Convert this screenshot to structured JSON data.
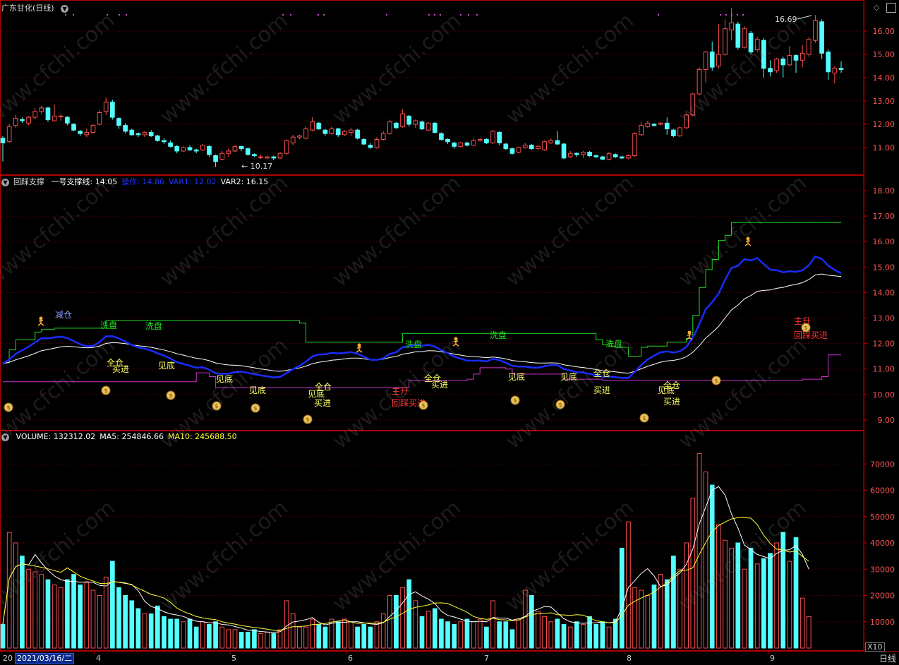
{
  "title": "广东甘化(日线)",
  "panel1": {
    "name": "回踩支撑",
    "fields": [
      {
        "label": "一号支撑线:",
        "value": "14.05",
        "color": "#ffffff"
      },
      {
        "label": "操作:",
        "value": "14.86",
        "color": "#2233ff"
      },
      {
        "label": "VAR1:",
        "value": "12.02",
        "color": "#2233ff"
      },
      {
        "label": "VAR2:",
        "value": "16.15",
        "color": "#ffffff"
      }
    ]
  },
  "panel2": {
    "fields": [
      {
        "label": "VOLUME:",
        "value": "132312.02",
        "color": "#ffffff"
      },
      {
        "label": "MA5:",
        "value": "254846.66",
        "color": "#ffffff"
      },
      {
        "label": "MA10:",
        "value": "245688.50",
        "color": "#ffff33"
      }
    ]
  },
  "price_axis": [
    "16.00",
    "15.00",
    "14.00",
    "13.00",
    "12.00",
    "11.00"
  ],
  "ind_axis": [
    "18.00",
    "17.00",
    "16.00",
    "15.00",
    "14.00",
    "13.00",
    "12.00",
    "11.00",
    "10.00",
    "9.00"
  ],
  "vol_axis": [
    "70000",
    "60000",
    "50000",
    "40000",
    "30000",
    "20000",
    "10000"
  ],
  "high_label": "16.69",
  "low_label": "10.17",
  "x_labels": [
    "20",
    "4",
    "5",
    "6",
    "7",
    "8",
    "9"
  ],
  "date_selected": "2021/03/16/二",
  "period_tab": "日线",
  "scale_label": "X10",
  "watermark": "www.cfchi.com",
  "signals": {
    "jiancang": "减仓",
    "xipan": "洗盘",
    "jiandi": "见底",
    "quancang": "全仓",
    "mairu": "买进",
    "zhusheng": "主升",
    "huicai": "回踩买进"
  },
  "colors": {
    "up": "#ff4f4f",
    "down": "#54ffff",
    "grid": "#7a0000",
    "border": "#b00000",
    "axis_text": "#ff5555"
  },
  "chart_data": {
    "type": "candlestick",
    "candles": [
      [
        11.4,
        11.2,
        10.4,
        11.5
      ],
      [
        11.25,
        11.9,
        11.2,
        12.0
      ],
      [
        11.95,
        12.25,
        11.85,
        12.4
      ],
      [
        12.2,
        12.15,
        12.05,
        12.3
      ],
      [
        12.05,
        12.3,
        11.95,
        12.35
      ],
      [
        12.3,
        12.55,
        12.2,
        12.7
      ],
      [
        12.55,
        12.7,
        12.45,
        12.8
      ],
      [
        12.7,
        12.2,
        12.1,
        12.75
      ],
      [
        12.15,
        12.35,
        12.1,
        12.85
      ],
      [
        12.35,
        12.35,
        12.15,
        12.45
      ],
      [
        12.3,
        12.05,
        11.95,
        12.35
      ],
      [
        12.0,
        11.75,
        11.7,
        12.05
      ],
      [
        11.7,
        11.6,
        11.5,
        11.75
      ],
      [
        11.55,
        11.65,
        11.45,
        11.8
      ],
      [
        11.65,
        11.95,
        11.6,
        12.0
      ],
      [
        12.0,
        12.5,
        11.95,
        12.6
      ],
      [
        12.55,
        12.95,
        12.4,
        13.15
      ],
      [
        12.95,
        12.3,
        12.2,
        13.05
      ],
      [
        12.25,
        11.95,
        11.8,
        12.3
      ],
      [
        11.95,
        11.7,
        11.6,
        12.05
      ],
      [
        11.75,
        11.55,
        11.5,
        11.8
      ],
      [
        11.6,
        11.55,
        11.45,
        11.65
      ],
      [
        11.55,
        11.65,
        11.45,
        11.7
      ],
      [
        11.65,
        11.5,
        11.45,
        11.75
      ],
      [
        11.5,
        11.3,
        11.25,
        11.55
      ],
      [
        11.3,
        11.25,
        11.15,
        11.4
      ],
      [
        11.2,
        11.05,
        11.0,
        11.3
      ],
      [
        11.05,
        10.85,
        10.75,
        11.1
      ],
      [
        10.85,
        11.0,
        10.8,
        11.05
      ],
      [
        11.0,
        10.9,
        10.85,
        11.1
      ],
      [
        10.9,
        10.85,
        10.75,
        10.95
      ],
      [
        10.9,
        11.1,
        10.85,
        11.15
      ],
      [
        11.05,
        10.7,
        10.6,
        11.1
      ],
      [
        10.65,
        10.4,
        10.17,
        10.7
      ],
      [
        10.5,
        10.75,
        10.45,
        10.85
      ],
      [
        10.75,
        10.85,
        10.6,
        10.95
      ],
      [
        10.85,
        11.05,
        10.8,
        11.1
      ],
      [
        11.05,
        10.95,
        10.85,
        11.05
      ],
      [
        10.95,
        10.7,
        10.65,
        11.0
      ],
      [
        10.7,
        10.65,
        10.6,
        10.75
      ],
      [
        10.6,
        10.6,
        10.5,
        10.7
      ],
      [
        10.55,
        10.6,
        10.5,
        10.65
      ],
      [
        10.6,
        10.55,
        10.45,
        10.65
      ],
      [
        10.55,
        10.75,
        10.5,
        10.8
      ],
      [
        10.75,
        11.3,
        10.7,
        11.35
      ],
      [
        11.2,
        11.45,
        11.1,
        11.55
      ],
      [
        11.45,
        11.5,
        11.35,
        11.55
      ],
      [
        11.4,
        11.8,
        11.35,
        11.9
      ],
      [
        11.75,
        12.1,
        11.7,
        12.3
      ],
      [
        12.05,
        11.8,
        11.75,
        12.1
      ],
      [
        11.75,
        11.6,
        11.5,
        11.8
      ],
      [
        11.6,
        11.8,
        11.55,
        11.9
      ],
      [
        11.8,
        11.55,
        11.45,
        11.85
      ],
      [
        11.55,
        11.7,
        11.5,
        11.75
      ],
      [
        11.65,
        11.75,
        11.5,
        11.85
      ],
      [
        11.75,
        11.4,
        11.35,
        11.8
      ],
      [
        11.35,
        11.15,
        11.1,
        11.4
      ],
      [
        11.1,
        11.0,
        10.95,
        11.2
      ],
      [
        11.0,
        11.35,
        10.95,
        11.45
      ],
      [
        11.35,
        11.6,
        11.3,
        11.7
      ],
      [
        11.6,
        12.1,
        11.55,
        12.2
      ],
      [
        12.05,
        11.85,
        11.8,
        12.1
      ],
      [
        11.9,
        12.45,
        11.85,
        12.65
      ],
      [
        12.35,
        12.0,
        11.9,
        12.4
      ],
      [
        12.0,
        12.15,
        11.85,
        12.2
      ],
      [
        12.1,
        11.8,
        11.75,
        12.15
      ],
      [
        11.75,
        12.05,
        11.7,
        12.1
      ],
      [
        12.05,
        11.65,
        11.6,
        12.1
      ],
      [
        11.6,
        11.35,
        11.3,
        11.65
      ],
      [
        11.35,
        11.25,
        11.15,
        11.4
      ],
      [
        11.2,
        11.05,
        10.95,
        11.25
      ],
      [
        11.05,
        11.2,
        11.0,
        11.25
      ],
      [
        11.2,
        11.1,
        11.05,
        11.25
      ],
      [
        11.1,
        11.3,
        11.05,
        11.4
      ],
      [
        11.3,
        11.35,
        11.25,
        11.4
      ],
      [
        11.35,
        11.2,
        11.15,
        11.4
      ],
      [
        11.2,
        11.7,
        11.15,
        11.75
      ],
      [
        11.65,
        11.2,
        11.1,
        11.7
      ],
      [
        11.15,
        10.95,
        10.9,
        11.2
      ],
      [
        10.95,
        10.75,
        10.7,
        11.0
      ],
      [
        10.8,
        11.0,
        10.75,
        11.05
      ],
      [
        11.0,
        11.1,
        10.95,
        11.2
      ],
      [
        11.1,
        10.95,
        10.9,
        11.15
      ],
      [
        10.95,
        11.05,
        10.9,
        11.1
      ],
      [
        10.9,
        11.25,
        10.85,
        11.3
      ],
      [
        11.2,
        11.3,
        11.15,
        11.4
      ],
      [
        11.3,
        11.15,
        11.1,
        11.7
      ],
      [
        11.15,
        10.55,
        10.5,
        11.2
      ],
      [
        10.6,
        10.75,
        10.55,
        10.85
      ],
      [
        10.75,
        10.7,
        10.6,
        10.8
      ],
      [
        10.7,
        10.8,
        10.55,
        10.85
      ],
      [
        10.8,
        10.65,
        10.6,
        10.85
      ],
      [
        10.65,
        10.6,
        10.55,
        10.7
      ],
      [
        10.6,
        10.5,
        10.45,
        10.65
      ],
      [
        10.5,
        10.75,
        10.45,
        10.8
      ],
      [
        10.7,
        10.6,
        10.55,
        10.75
      ],
      [
        10.6,
        10.55,
        10.5,
        10.65
      ],
      [
        10.55,
        10.65,
        10.5,
        10.7
      ],
      [
        10.65,
        11.6,
        10.6,
        11.65
      ],
      [
        11.55,
        11.95,
        11.5,
        12.1
      ],
      [
        11.9,
        12.05,
        11.85,
        12.15
      ],
      [
        12.0,
        11.95,
        11.9,
        12.05
      ],
      [
        12.0,
        12.05,
        11.95,
        12.1
      ],
      [
        12.05,
        11.8,
        11.55,
        12.3
      ],
      [
        11.75,
        11.5,
        11.45,
        11.8
      ],
      [
        11.5,
        11.85,
        11.45,
        11.9
      ],
      [
        11.85,
        12.4,
        11.8,
        12.45
      ],
      [
        12.4,
        13.3,
        12.35,
        13.35
      ],
      [
        13.3,
        14.35,
        13.25,
        14.45
      ],
      [
        14.35,
        15.1,
        13.8,
        15.15
      ],
      [
        15.1,
        14.45,
        14.3,
        15.55
      ],
      [
        14.5,
        15.0,
        14.4,
        16.3
      ],
      [
        15.0,
        16.1,
        14.95,
        16.5
      ],
      [
        16.05,
        16.35,
        15.6,
        17.0
      ],
      [
        16.3,
        15.3,
        15.2,
        16.4
      ],
      [
        15.3,
        16.1,
        15.25,
        16.2
      ],
      [
        15.9,
        15.1,
        15.0,
        16.0
      ],
      [
        15.2,
        15.65,
        15.1,
        15.75
      ],
      [
        15.6,
        14.4,
        14.0,
        15.7
      ],
      [
        14.4,
        14.25,
        14.05,
        14.75
      ],
      [
        14.3,
        14.8,
        14.2,
        14.85
      ],
      [
        14.8,
        14.55,
        14.0,
        14.9
      ],
      [
        14.55,
        14.95,
        14.5,
        15.35
      ],
      [
        14.95,
        14.75,
        14.2,
        15.0
      ],
      [
        14.75,
        15.05,
        14.45,
        15.4
      ],
      [
        15.0,
        15.65,
        14.9,
        15.75
      ],
      [
        15.6,
        16.45,
        15.5,
        16.69
      ],
      [
        16.4,
        15.05,
        14.8,
        16.5
      ],
      [
        15.1,
        14.25,
        13.9,
        15.2
      ],
      [
        14.2,
        14.4,
        13.75,
        14.5
      ],
      [
        14.4,
        14.35,
        14.2,
        14.7
      ]
    ],
    "volume": [
      90,
      440,
      400,
      350,
      300,
      290,
      280,
      260,
      240,
      230,
      260,
      280,
      240,
      250,
      220,
      200,
      270,
      330,
      230,
      200,
      180,
      150,
      130,
      130,
      160,
      120,
      110,
      110,
      100,
      110,
      80,
      100,
      90,
      100,
      80,
      70,
      70,
      60,
      60,
      70,
      55,
      60,
      55,
      70,
      180,
      130,
      80,
      80,
      110,
      90,
      80,
      110,
      100,
      110,
      100,
      80,
      90,
      80,
      100,
      130,
      200,
      200,
      230,
      260,
      180,
      120,
      140,
      150,
      110,
      100,
      90,
      100,
      110,
      100,
      110,
      80,
      180,
      100,
      100,
      70,
      110,
      220,
      200,
      140,
      120,
      100,
      110,
      90,
      80,
      100,
      90,
      120,
      90,
      100,
      80,
      110,
      380,
      480,
      230,
      220,
      200,
      240,
      280,
      260,
      350,
      300,
      400,
      570,
      740,
      670,
      620,
      470,
      410,
      380,
      400,
      300,
      380,
      320,
      340,
      360,
      400,
      440,
      330,
      420,
      190,
      120
    ],
    "ylim_price": [
      10.0,
      17.0
    ],
    "ylim_indicator": [
      9.0,
      18.0
    ],
    "ylim_volume": [
      0,
      80000
    ]
  }
}
